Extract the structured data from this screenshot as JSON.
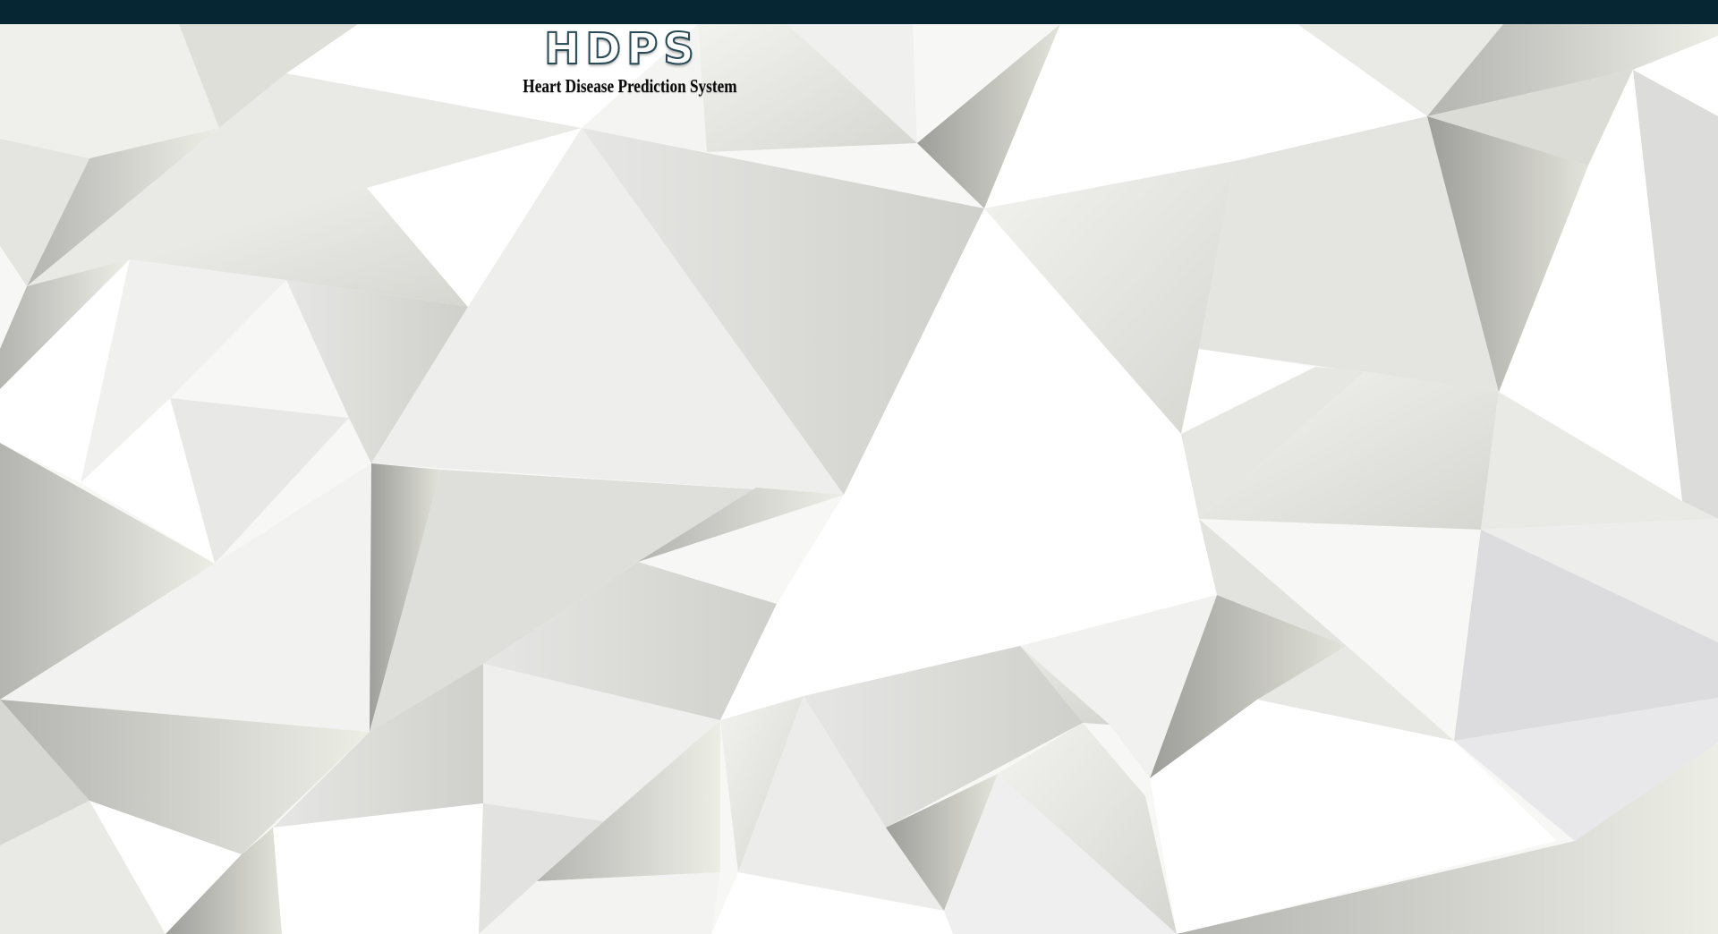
{
  "app": {
    "logo_text": "HDPS",
    "tagline": "Heart Disease Prediction System"
  },
  "theme": {
    "topbar_color": "#062633",
    "background_pattern": "low-poly-white-grey"
  }
}
